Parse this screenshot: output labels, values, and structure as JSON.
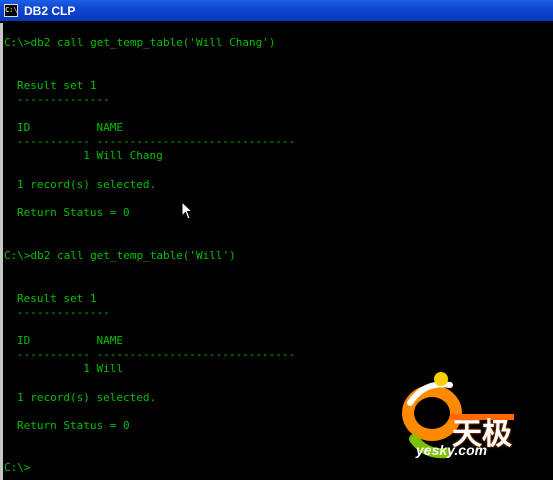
{
  "window": {
    "title": "DB2 CLP",
    "icon_text": "C:\\"
  },
  "console": {
    "lines": [
      "C:\\>db2 call get_temp_table('Will Chang')",
      "Result set 1",
      "--------------",
      "ID          NAME",
      "----------- ------------------------------",
      "          1 Will Chang",
      "1 record(s) selected.",
      "Return Status = 0",
      "C:\\>db2 call get_temp_table('Will')",
      "Result set 1",
      "--------------",
      "ID          NAME",
      "----------- ------------------------------",
      "          1 Will",
      "1 record(s) selected.",
      "Return Status = 0",
      "C:\\>"
    ]
  },
  "watermark": {
    "cn_text": "天极",
    "site_text": "yesky.com"
  },
  "colors": {
    "console_bg": "#000000",
    "console_text": "#00c000",
    "titlebar": "#0b45d0"
  }
}
